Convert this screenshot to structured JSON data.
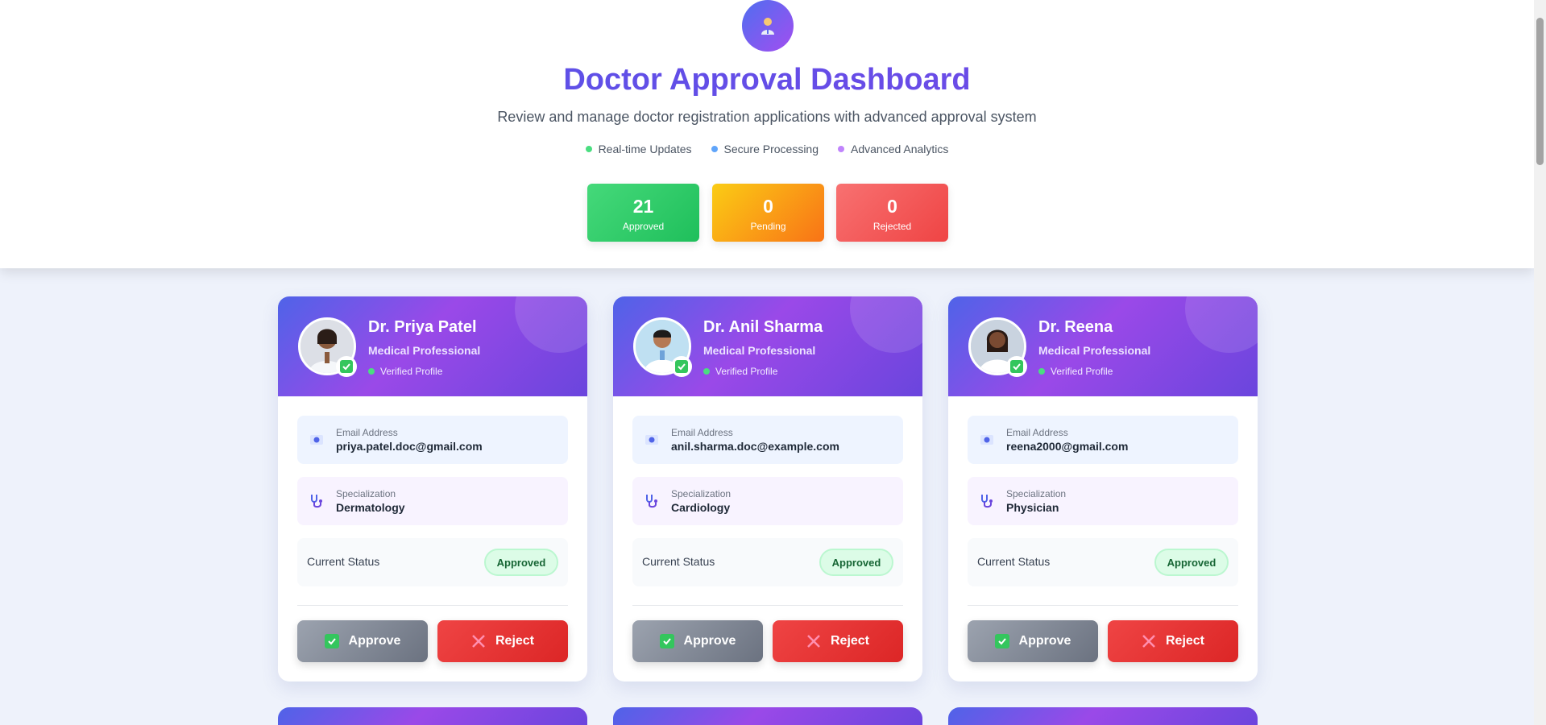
{
  "header": {
    "title": "Doctor Approval Dashboard",
    "subtitle": "Review and manage doctor registration applications with advanced approval system",
    "features": [
      {
        "label": "Real-time Updates",
        "color": "#4ade80"
      },
      {
        "label": "Secure Processing",
        "color": "#60a5fa"
      },
      {
        "label": "Advanced Analytics",
        "color": "#c084fc"
      }
    ]
  },
  "stats": {
    "approved": {
      "value": "21",
      "label": "Approved"
    },
    "pending": {
      "value": "0",
      "label": "Pending"
    },
    "rejected": {
      "value": "0",
      "label": "Rejected"
    }
  },
  "card_labels": {
    "role": "Medical Professional",
    "verified": "Verified Profile",
    "email_label": "Email Address",
    "spec_label": "Specialization",
    "status_label": "Current Status",
    "approve": "Approve",
    "reject": "Reject"
  },
  "doctors": [
    {
      "name": "Dr. Priya Patel",
      "email": "priya.patel.doc@gmail.com",
      "specialization": "Dermatology",
      "status": "Approved"
    },
    {
      "name": "Dr. Anil Sharma",
      "email": "anil.sharma.doc@example.com",
      "specialization": "Cardiology",
      "status": "Approved"
    },
    {
      "name": "Dr. Reena",
      "email": "reena2000@gmail.com",
      "specialization": "Physician",
      "status": "Approved"
    }
  ]
}
